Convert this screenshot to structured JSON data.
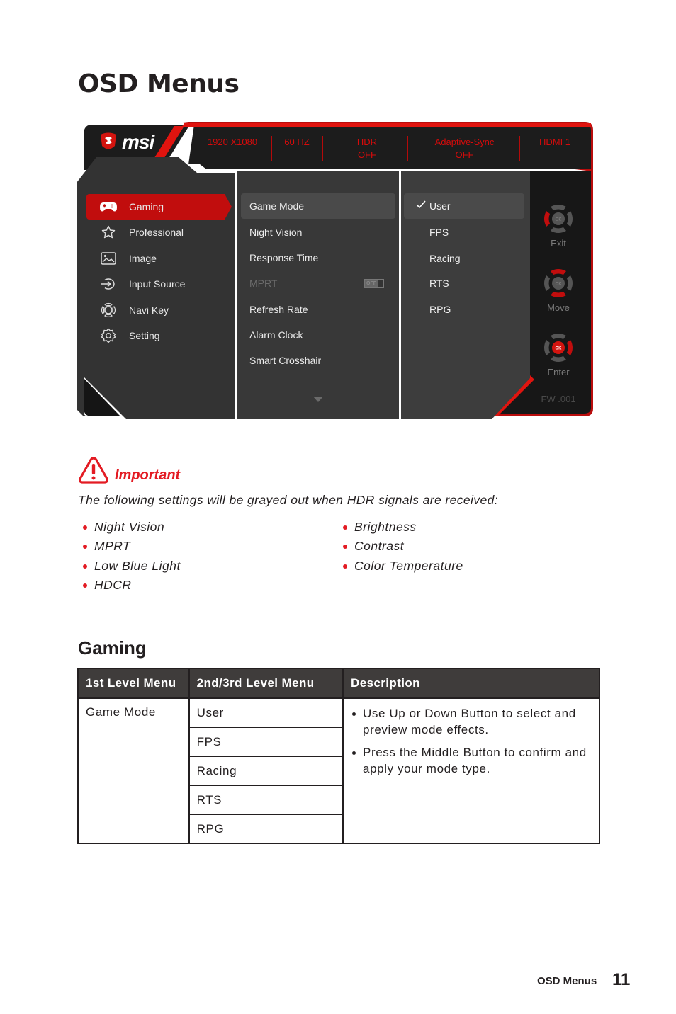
{
  "page": {
    "title": "OSD Menus",
    "footer_section": "OSD Menus",
    "page_number": "11"
  },
  "osd": {
    "brand": "msi",
    "status_bar": [
      {
        "line1": "1920 X1080",
        "line2": ""
      },
      {
        "line1": "60 HZ",
        "line2": ""
      },
      {
        "line1": "HDR",
        "line2": "OFF"
      },
      {
        "line1": "Adaptive-Sync",
        "line2": "OFF"
      },
      {
        "line1": "HDMI 1",
        "line2": ""
      }
    ],
    "level1": [
      {
        "label": "Gaming",
        "icon": "gamepad-icon",
        "active": true
      },
      {
        "label": "Professional",
        "icon": "star-icon",
        "active": false
      },
      {
        "label": "Image",
        "icon": "image-icon",
        "active": false
      },
      {
        "label": "Input Source",
        "icon": "input-source-icon",
        "active": false
      },
      {
        "label": "Navi Key",
        "icon": "navi-key-icon",
        "active": false
      },
      {
        "label": "Setting",
        "icon": "gear-icon",
        "active": false
      }
    ],
    "level2": [
      {
        "label": "Game Mode",
        "active": true
      },
      {
        "label": "Night Vision"
      },
      {
        "label": "Response Time"
      },
      {
        "label": "MPRT",
        "disabled": true,
        "toggle": "OFF"
      },
      {
        "label": "Refresh Rate"
      },
      {
        "label": "Alarm Clock"
      },
      {
        "label": "Smart Crosshair"
      }
    ],
    "level3": [
      {
        "label": "User",
        "active": true,
        "checked": true
      },
      {
        "label": "FPS"
      },
      {
        "label": "Racing"
      },
      {
        "label": "RTS"
      },
      {
        "label": "RPG"
      }
    ],
    "nav_buttons": [
      {
        "label": "Exit",
        "highlight": "left"
      },
      {
        "label": "Move",
        "highlight": "up-down"
      },
      {
        "label": "Enter",
        "highlight": "ok-right"
      }
    ],
    "nav_ok_label": "OK",
    "firmware": "FW .001",
    "accent_color": "#c10d0d"
  },
  "important": {
    "title": "Important",
    "description": "The following settings will be grayed out when HDR signals are received:",
    "left_items": [
      "Night Vision",
      "MPRT",
      "Low Blue Light",
      "HDCR"
    ],
    "right_items": [
      "Brightness",
      "Contrast",
      "Color Temperature"
    ],
    "accent_color": "#e31b23"
  },
  "gaming_section": {
    "title": "Gaming",
    "table": {
      "headers": [
        "1st Level Menu",
        "2nd/3rd Level Menu",
        "Description"
      ],
      "first_level": "Game Mode",
      "second_level": [
        "User",
        "FPS",
        "Racing",
        "RTS",
        "RPG"
      ],
      "description": [
        "Use Up or Down Button to select and preview mode effects.",
        "Press the Middle Button to confirm and apply your mode type."
      ]
    }
  }
}
